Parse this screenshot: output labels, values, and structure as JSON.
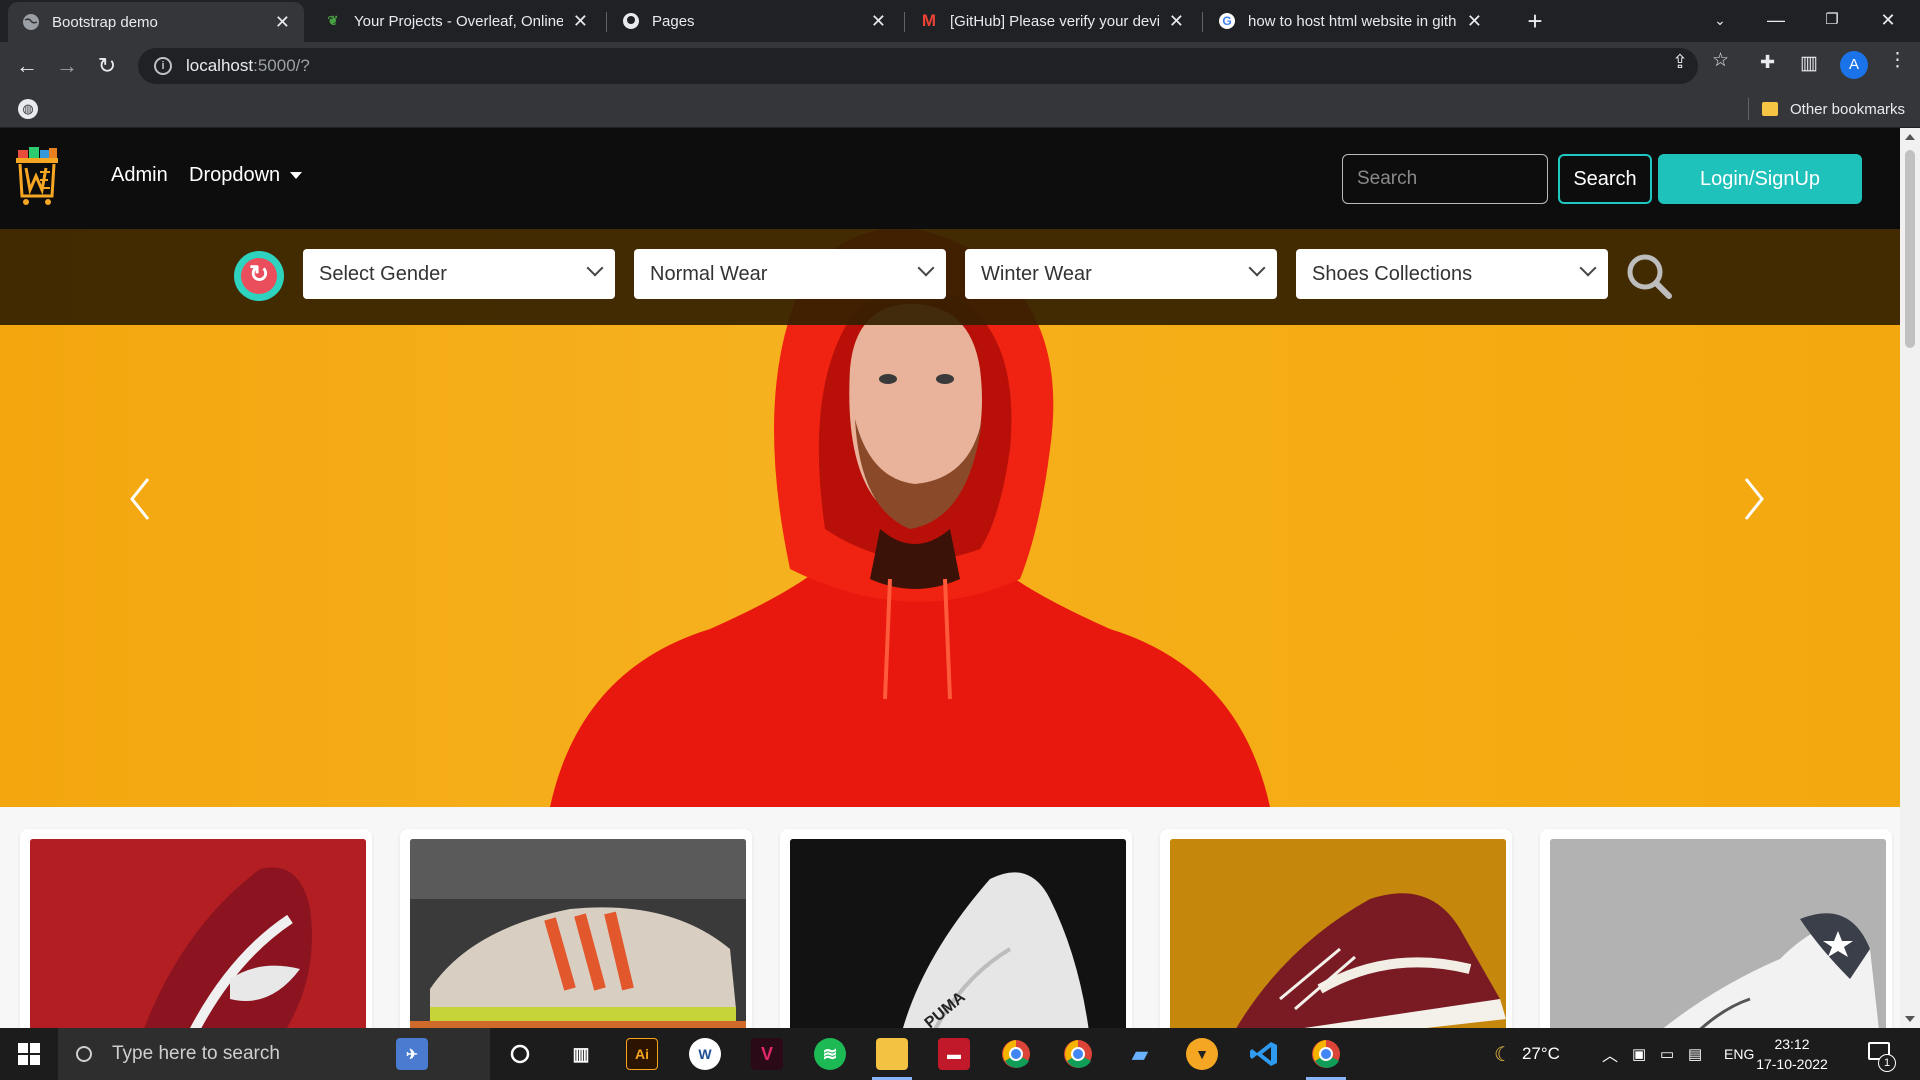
{
  "browser": {
    "tabs": [
      {
        "title": "Bootstrap demo",
        "active": true,
        "icon": "globe-icon"
      },
      {
        "title": "Your Projects - Overleaf, Online L",
        "active": false,
        "icon": "overleaf-icon"
      },
      {
        "title": "Pages",
        "active": false,
        "icon": "github-icon"
      },
      {
        "title": "[GitHub] Please verify your devic",
        "active": false,
        "icon": "gmail-icon"
      },
      {
        "title": "how to host html website in githu",
        "active": false,
        "icon": "google-icon"
      }
    ],
    "url_host": "localhost",
    "url_rest": ":5000/?",
    "other_bookmarks": "Other bookmarks",
    "profile_initial": "A"
  },
  "navbar": {
    "links": [
      "Admin",
      "Dropdown"
    ],
    "search_placeholder": "Search",
    "search_button": "Search",
    "login_button": "Login/SignUp"
  },
  "filters": {
    "selects": [
      "Select Gender",
      "Normal Wear",
      "Winter Wear",
      "Shoes Collections"
    ]
  },
  "products": [
    {
      "name": "red-nike-shoe",
      "color": "#b01d24"
    },
    {
      "name": "adidas-retro-shoe",
      "color": "#8a8a8a"
    },
    {
      "name": "white-puma-shoe",
      "color": "#121212"
    },
    {
      "name": "maroon-vans-shoe",
      "color": "#c88a0e"
    },
    {
      "name": "grey-star-shoe",
      "color": "#b4b4b4"
    }
  ],
  "taskbar": {
    "search_placeholder": "Type here to search",
    "weather": "27°C",
    "language": "ENG",
    "time": "23:12",
    "date": "17-10-2022",
    "notification_count": "1"
  },
  "colors": {
    "accent": "#1fc1bb",
    "hero_bg": "#f5ac14",
    "navbar_bg": "#0d0d0d"
  }
}
